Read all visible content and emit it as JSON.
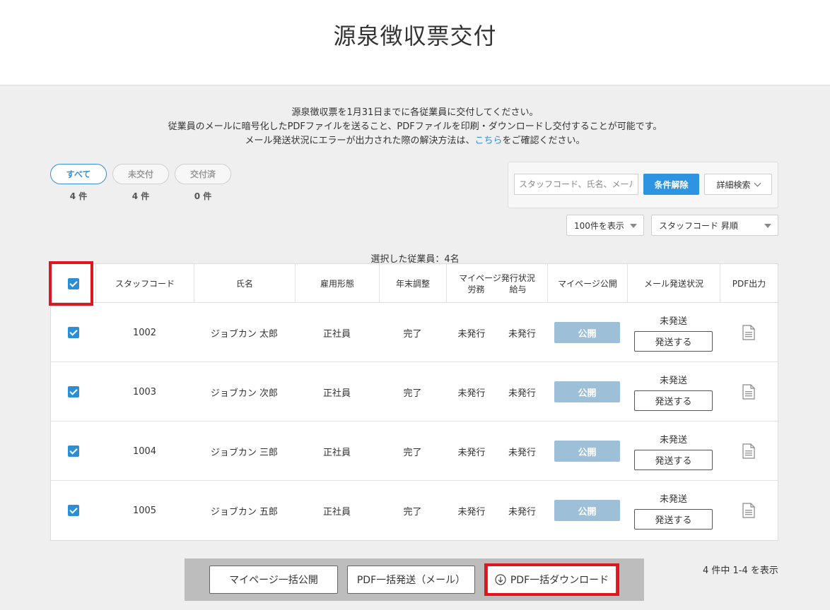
{
  "header": {
    "title": "源泉徴収票交付"
  },
  "notice": {
    "line1": "源泉徴収票を1月31日までに各従業員に交付してください。",
    "line2": "従業員のメールに暗号化したPDFファイルを送ること、PDFファイルを印刷・ダウンロードし交付することが可能です。",
    "line3_before": "メール発送状況にエラーが出力された際の解決方法は、",
    "line3_link": "こちら",
    "line3_after": "をご確認ください。"
  },
  "filters": [
    {
      "label": "すべて",
      "count": "4 件",
      "active": true
    },
    {
      "label": "未交付",
      "count": "4 件",
      "active": false
    },
    {
      "label": "交付済",
      "count": "0 件",
      "active": false
    }
  ],
  "search": {
    "placeholder": "スタッフコード、氏名、メール",
    "clear_label": "条件解除",
    "advanced_label": "詳細検索"
  },
  "per_page": {
    "selected": "100件を表示"
  },
  "sort": {
    "selected": "スタッフコード 昇順"
  },
  "selected_count": "選択した従業員：4名",
  "table": {
    "columns": {
      "staff_code": "スタッフコード",
      "name": "氏名",
      "employment": "雇用形態",
      "year_end": "年末調整",
      "mypage_status": "マイページ発行状況",
      "mypage_labor": "労務",
      "mypage_salary": "給与",
      "mypage_publish": "マイページ公開",
      "mail_status": "メール発送状況",
      "pdf_output": "PDF出力"
    },
    "rows": [
      {
        "code": "1002",
        "name": "ジョブカン 太郎",
        "employment": "正社員",
        "year_end": "完了",
        "labor": "未発行",
        "salary": "未発行",
        "publish": "公開",
        "mail_state": "未発送",
        "send": "発送する"
      },
      {
        "code": "1003",
        "name": "ジョブカン 次郎",
        "employment": "正社員",
        "year_end": "完了",
        "labor": "未発行",
        "salary": "未発行",
        "publish": "公開",
        "mail_state": "未発送",
        "send": "発送する"
      },
      {
        "code": "1004",
        "name": "ジョブカン 三郎",
        "employment": "正社員",
        "year_end": "完了",
        "labor": "未発行",
        "salary": "未発行",
        "publish": "公開",
        "mail_state": "未発送",
        "send": "発送する"
      },
      {
        "code": "1005",
        "name": "ジョブカン 五郎",
        "employment": "正社員",
        "year_end": "完了",
        "labor": "未発行",
        "salary": "未発行",
        "publish": "公開",
        "mail_state": "未発送",
        "send": "発送する"
      }
    ]
  },
  "bottom": {
    "bulk_publish": "マイページ一括公開",
    "bulk_mail": "PDF一括発送（メール）",
    "bulk_download": "PDF一括ダウンロード",
    "range": "4 件中 1-4 を表示"
  },
  "colors": {
    "accent": "#2c94e0",
    "highlight": "#e0151e",
    "publish_button": "#9dbfd8"
  }
}
